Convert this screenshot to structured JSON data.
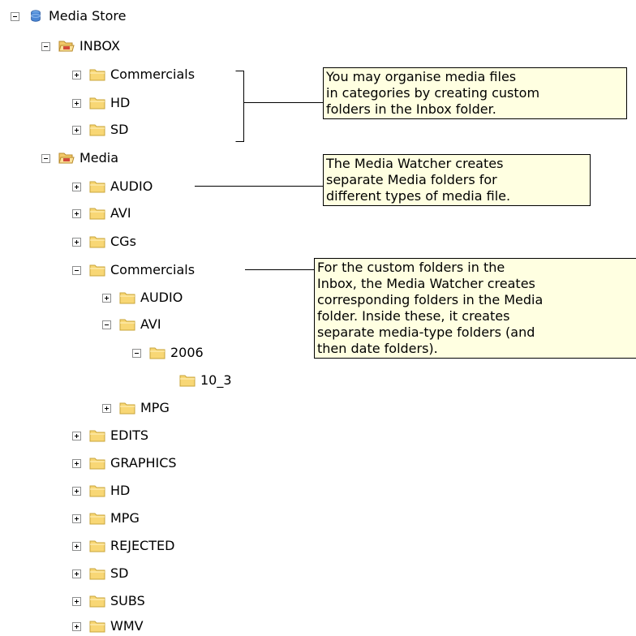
{
  "tree": {
    "root": {
      "label": "Media Store",
      "icon": "database-icon"
    },
    "inbox": {
      "label": "INBOX",
      "children": [
        "Commercials",
        "HD",
        "SD"
      ]
    },
    "media": {
      "label": "Media",
      "items": {
        "audio": "AUDIO",
        "avi": "AVI",
        "cgs": "CGs",
        "commercials": "Commercials",
        "comm_audio": "AUDIO",
        "comm_avi": "AVI",
        "year": "2006",
        "date": "10_3",
        "comm_mpg": "MPG",
        "edits": "EDITS",
        "graphics": "GRAPHICS",
        "hd": "HD",
        "mpg": "MPG",
        "rejected": "REJECTED",
        "sd": "SD",
        "subs": "SUBS",
        "wmv": "WMV"
      }
    }
  },
  "callouts": {
    "inbox": [
      "You may organise media files",
      "in categories by creating custom",
      "folders in the Inbox folder."
    ],
    "watcher": [
      "The Media Watcher creates",
      "separate Media folders for",
      "different types of media file."
    ],
    "custom": [
      "For the custom folders in the",
      "Inbox, the Media Watcher creates",
      "corresponding folders in the Media",
      "folder. Inside these, it creates",
      "separate media-type folders (and",
      "then date folders)."
    ]
  },
  "colors": {
    "callout_bg": "#ffffe1",
    "folder_fill": "#f8d775",
    "folder_stroke": "#c9a43a"
  }
}
